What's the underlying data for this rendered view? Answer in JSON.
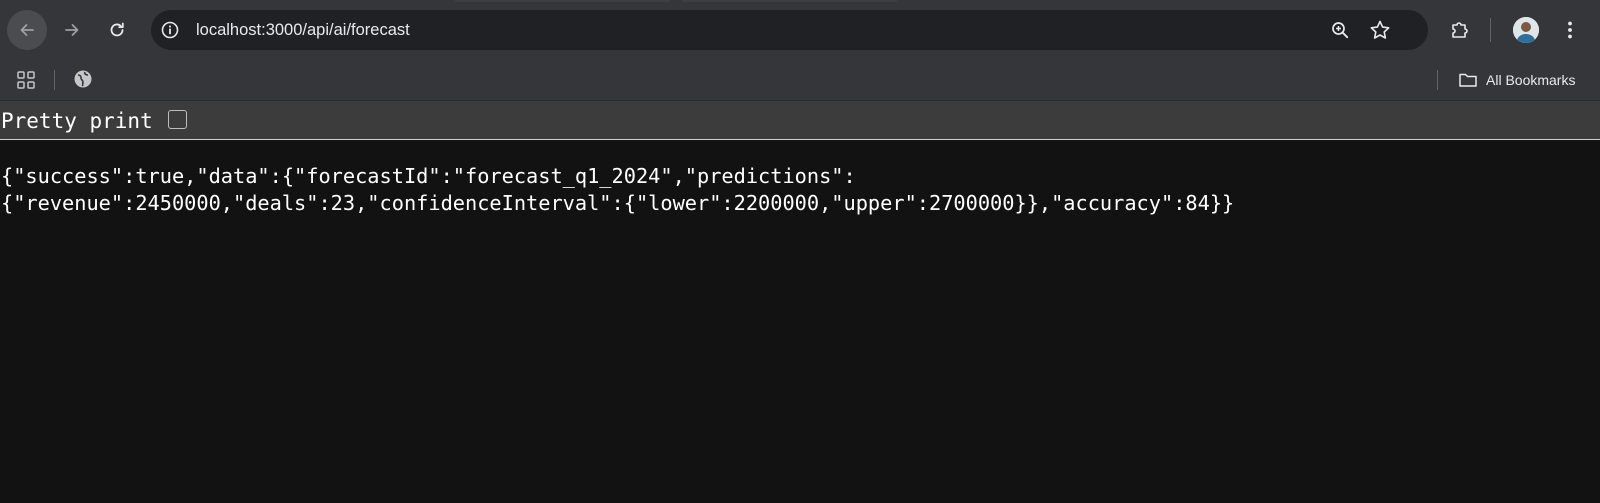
{
  "browser": {
    "url": "localhost:3000/api/ai/forecast",
    "bookmarks_label": "All Bookmarks"
  },
  "icons": {
    "back": "arrow-left-icon",
    "forward": "arrow-right-icon",
    "reload": "reload-icon",
    "site_info": "info-icon",
    "zoom": "zoom-icon",
    "bookmark": "star-icon",
    "extensions": "puzzle-icon",
    "profile": "avatar",
    "menu": "kebab-menu-icon",
    "apps": "apps-grid-icon",
    "bookmark_site": "globe-icon",
    "bookmarks_folder": "folder-icon"
  },
  "page": {
    "pretty_print_label": "Pretty print",
    "pretty_print_checked": false,
    "json_line1": "{\"success\":true,\"data\":{\"forecastId\":\"forecast_q1_2024\",\"predictions\":",
    "json_line2": "{\"revenue\":2450000,\"deals\":23,\"confidenceInterval\":{\"lower\":2200000,\"upper\":2700000}},\"accuracy\":84}}"
  },
  "colors": {
    "toolbar": "#35363a",
    "omnibox": "#202124",
    "page_bg": "#121212",
    "pretty_print_bar": "#3c3c3c",
    "text": "#ffffff"
  }
}
